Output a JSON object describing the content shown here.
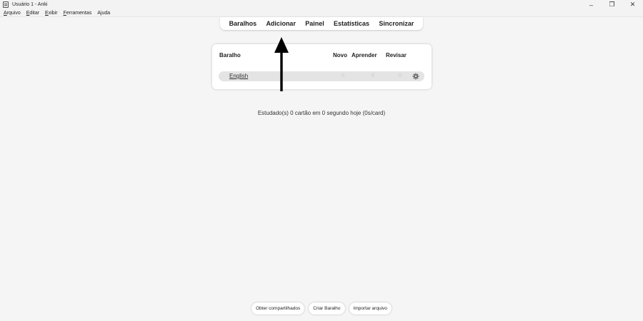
{
  "window": {
    "title": "Usuário 1 - Anki",
    "icon": "anki-app-icon",
    "controls": {
      "minimize": "–",
      "restore": "❐",
      "close": "✕"
    }
  },
  "menu": {
    "items": [
      {
        "label": "Arquivo",
        "accel": "A",
        "rest": "rquivo"
      },
      {
        "label": "Editar",
        "accel": "E",
        "rest": "ditar"
      },
      {
        "label": "Exibir",
        "accel": "E",
        "rest": "xibir"
      },
      {
        "label": "Ferramentas",
        "accel": "F",
        "rest": "erramentas"
      },
      {
        "label": "Ajuda",
        "accel": "",
        "rest": "Ajuda"
      }
    ]
  },
  "toolbar": {
    "decks": "Baralhos",
    "add": "Adicionar",
    "browse": "Painel",
    "stats": "Estatísticas",
    "sync": "Sincronizar"
  },
  "deck_list": {
    "headers": {
      "deck": "Baralho",
      "new": "Novo",
      "learn": "Aprender",
      "review": "Revisar"
    },
    "rows": [
      {
        "name": "English",
        "new": "0",
        "learn": "0",
        "review": "0",
        "options_icon": "gear-icon"
      }
    ]
  },
  "stats_line": "Estudado(s) 0 cartão em 0 segundo hoje (0s/card)",
  "bottom_buttons": {
    "shared": "Obter compartilhados",
    "create": "Criar Baralho",
    "import": "Importar arquivo"
  },
  "colors": {
    "background": "#f5f5f5",
    "panel": "#ffffff",
    "row": "#e4e4e4",
    "arrow": "#000000"
  }
}
